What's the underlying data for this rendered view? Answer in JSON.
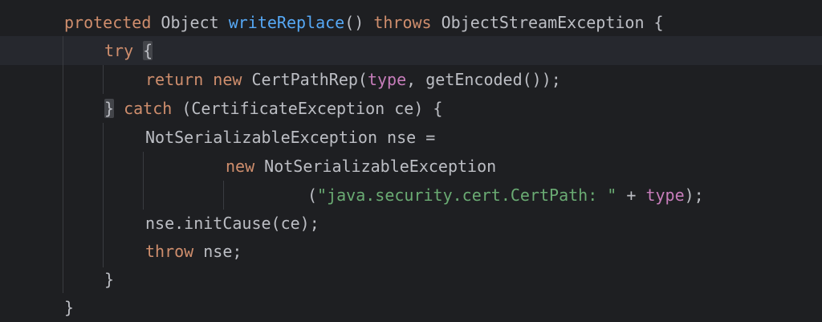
{
  "code": {
    "line1": {
      "kw_protected": "protected",
      "t_object": " Object ",
      "fn_writeReplace": "writeReplace",
      "t_parens": "() ",
      "kw_throws": "throws",
      "t_rest": " ObjectStreamException {"
    },
    "line2": {
      "kw_try": "try",
      "t_space": " ",
      "brace": "{"
    },
    "line3": {
      "kw_return": "return",
      "t_sp1": " ",
      "kw_new": "new",
      "t_ctor": " CertPathRep(",
      "fld_type": "type",
      "t_rest": ", getEncoded());"
    },
    "line4": {
      "brace": "}",
      "t_sp": " ",
      "kw_catch": "catch",
      "t_rest": " (CertificateException ce) {"
    },
    "line5": {
      "t_text": "NotSerializableException nse ="
    },
    "line6": {
      "kw_new": "new",
      "t_rest": " NotSerializableException"
    },
    "line7": {
      "t_open": "(",
      "str": "\"java.security.cert.CertPath: \"",
      "t_plus": " + ",
      "fld_type": "type",
      "t_close": ");"
    },
    "line8": {
      "t_text": "nse.initCause(ce);"
    },
    "line9": {
      "kw_throw": "throw",
      "t_rest": " nse;"
    },
    "line10": {
      "t_text": "}"
    },
    "line11": {
      "t_text": "}"
    }
  },
  "colors": {
    "background": "#1e1f22",
    "keyword": "#cf8e6d",
    "method": "#56a8f5",
    "field": "#c77dbb",
    "string": "#6aab73",
    "text": "#bcbec4"
  }
}
